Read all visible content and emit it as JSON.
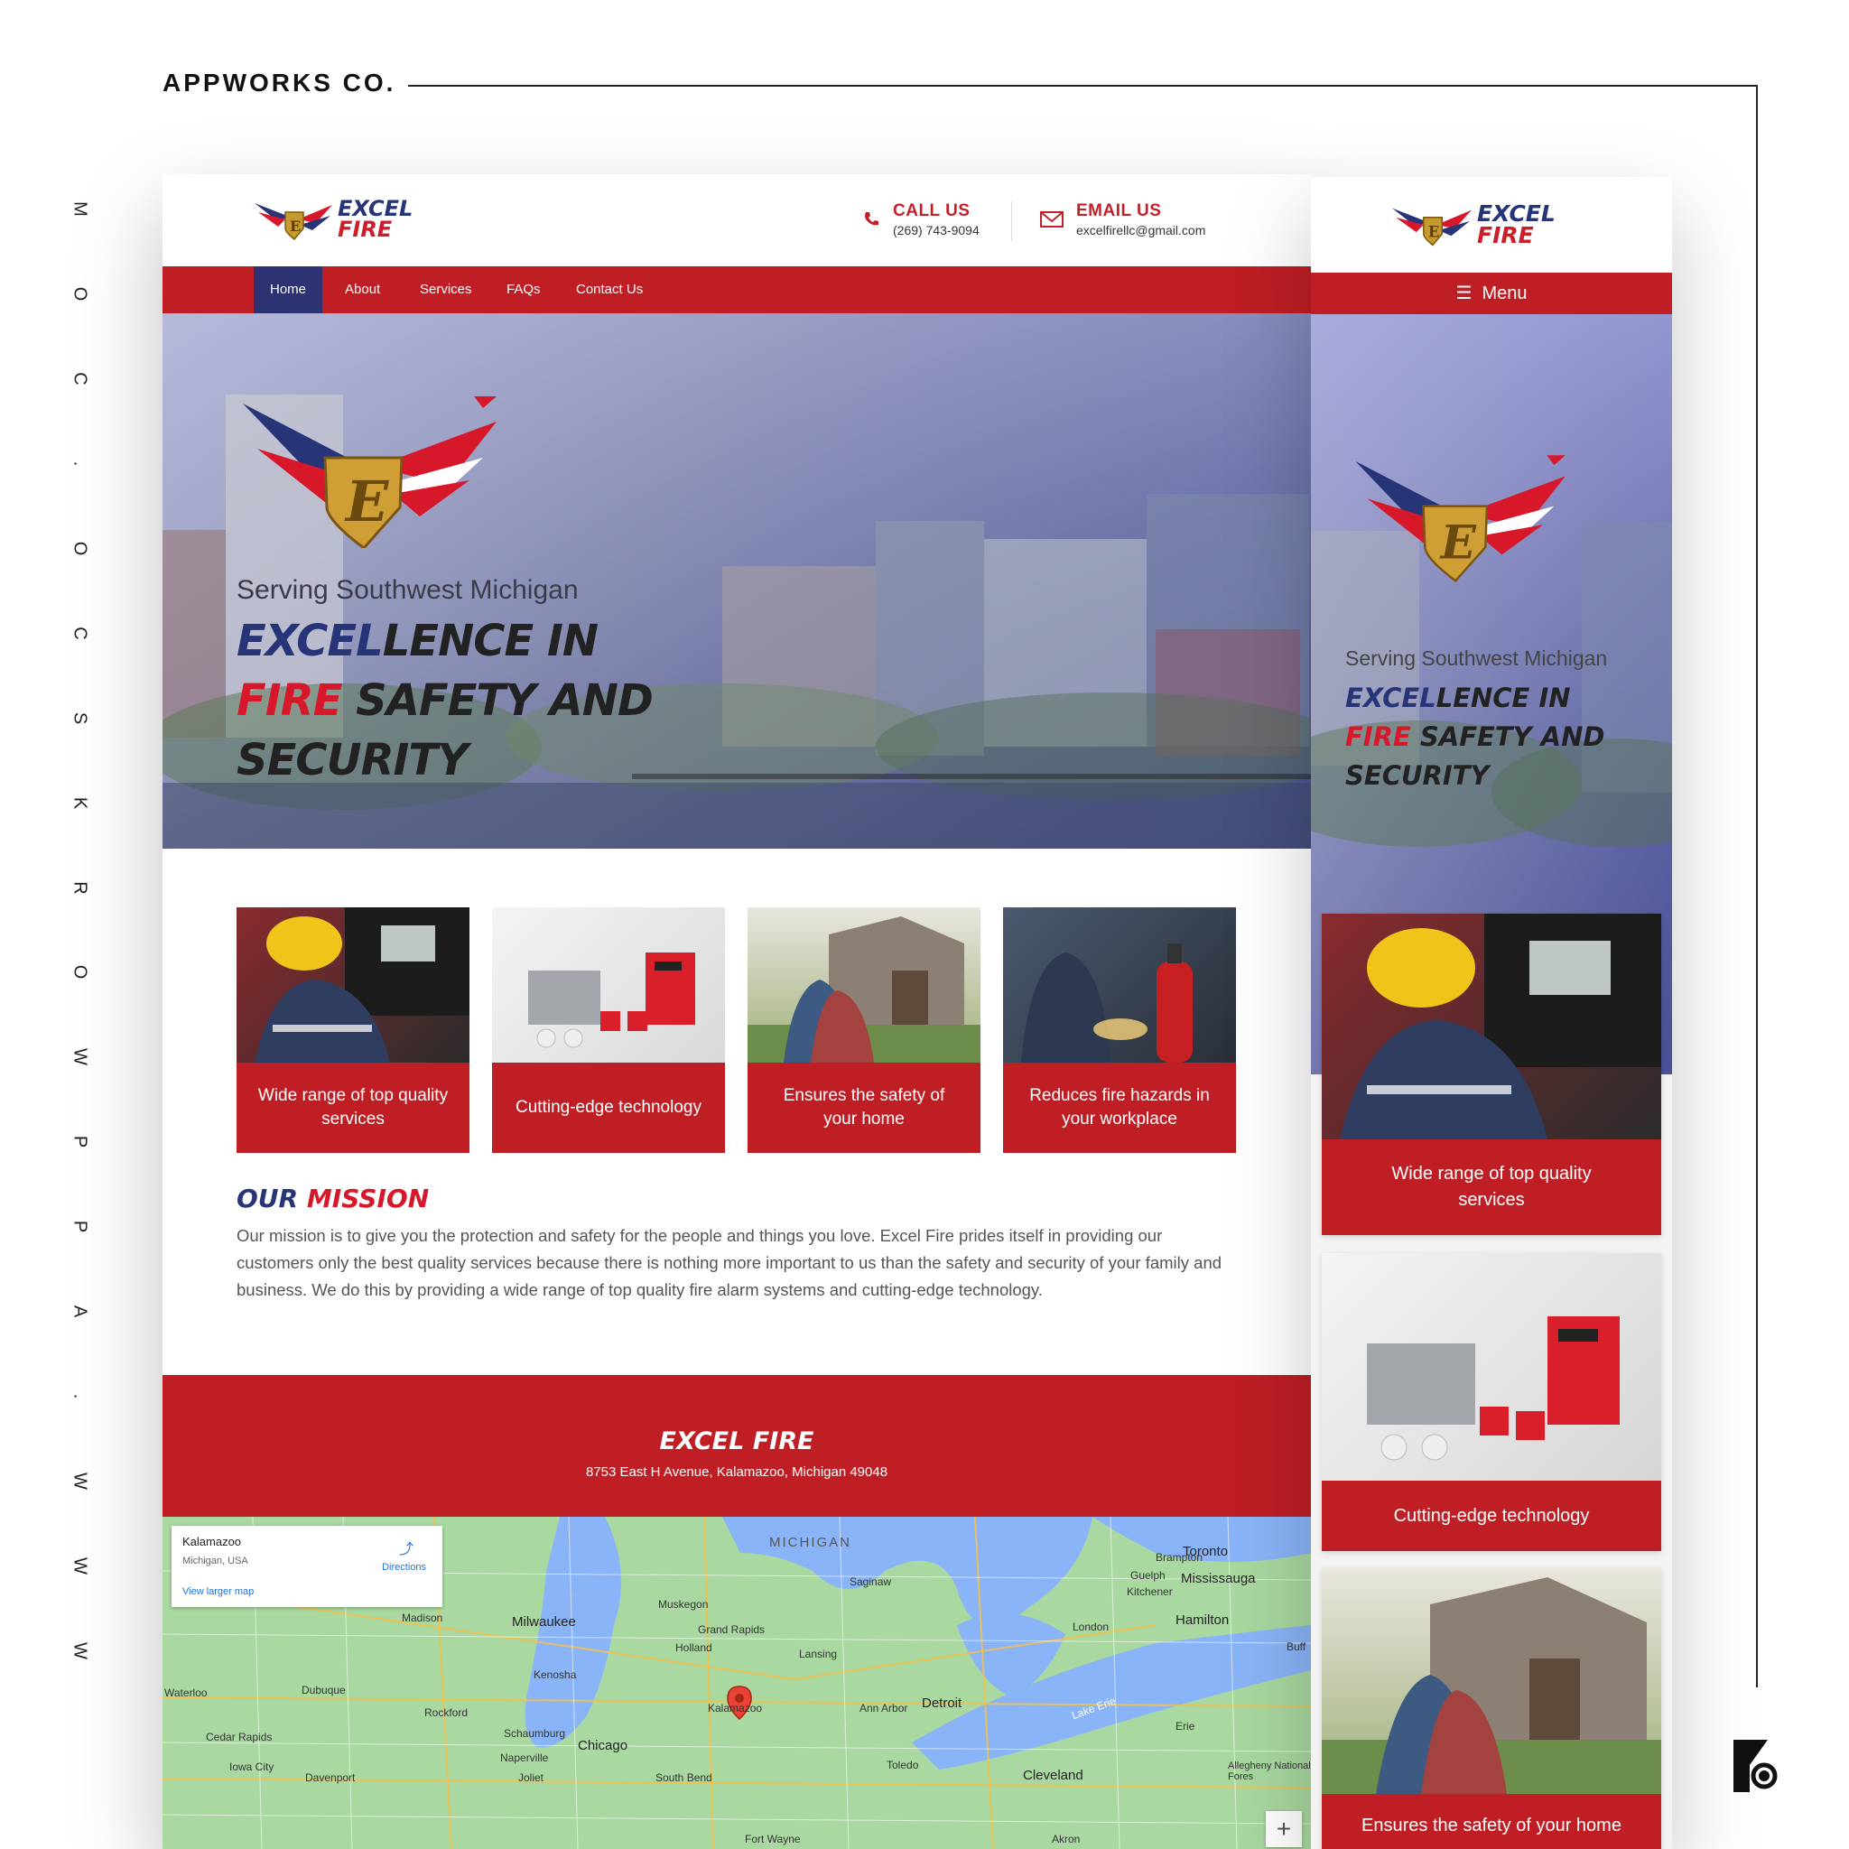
{
  "brand": "APPWORKS CO.",
  "vertical_text": [
    "W",
    "W",
    "W",
    ".",
    "A",
    "P",
    "P",
    "W",
    "O",
    "R",
    "K",
    "S",
    "C",
    "O",
    ".",
    "C",
    "O",
    "M"
  ],
  "logo": {
    "line1": "EXCEL",
    "line2": "FIRE"
  },
  "contact": {
    "call_label": "CALL US",
    "call_value": "(269) 743-9094",
    "email_label": "EMAIL US",
    "email_value": "excelfirellc@gmail.com"
  },
  "nav": [
    "Home",
    "About",
    "Services",
    "FAQs",
    "Contact Us"
  ],
  "nav_active": "Home",
  "hero": {
    "tagline": "Serving Southwest Michigan",
    "title_part1": "EXCEL",
    "title_part2": "LENCE IN",
    "title_part3": "FIRE",
    "title_part4": "SAFETY AND",
    "title_part5": "SECURITY"
  },
  "cards": [
    {
      "caption": "Wide range of top quality services"
    },
    {
      "caption": "Cutting-edge technology"
    },
    {
      "caption": "Ensures the safety of your home"
    },
    {
      "caption": "Reduces fire hazards in your workplace"
    }
  ],
  "mission": {
    "title_a": "OUR",
    "title_b": "MISSION",
    "text": "Our mission is to give you the protection and safety for the people and things you love. Excel Fire prides itself in providing our customers only the best quality services because there is nothing more important to us than the safety and security of your family and business. We do this by providing a wide range of top quality fire alarm systems and cutting-edge technology."
  },
  "footer": {
    "name": "EXCEL FIRE",
    "address": "8753 East H Avenue, Kalamazoo, Michigan 49048"
  },
  "map": {
    "place": "Kalamazoo",
    "region": "Michigan, USA",
    "directions": "Directions",
    "larger_map": "View larger map",
    "labels": [
      "MICHIGAN",
      "Toronto",
      "Mississauga",
      "Brampton",
      "Guelph",
      "Kitchener",
      "Hamilton",
      "London",
      "Madison",
      "Milwaukee",
      "Muskegon",
      "Saginaw",
      "Grand Rapids",
      "Holland",
      "Lansing",
      "Kalamazoo",
      "Ann Arbor",
      "Detroit",
      "Kenosha",
      "Rockford",
      "Dubuque",
      "Waterloo",
      "Cedar Rapids",
      "Iowa City",
      "Davenport",
      "Chicago",
      "Schaumburg",
      "Naperville",
      "Joliet",
      "South Bend",
      "Toledo",
      "Cleveland",
      "Erie",
      "Fort Wayne",
      "Akron",
      "Lake Erie",
      "Allegheny National Fores",
      "Buff"
    ]
  },
  "mobile": {
    "menu": "Menu",
    "cards": [
      {
        "caption": "Wide range of top quality services"
      },
      {
        "caption": "Cutting-edge technology"
      },
      {
        "caption": "Ensures the safety of your home"
      }
    ]
  },
  "colors": {
    "red": "#be1e24",
    "navy": "#283478",
    "hero_red": "#d7182b"
  }
}
